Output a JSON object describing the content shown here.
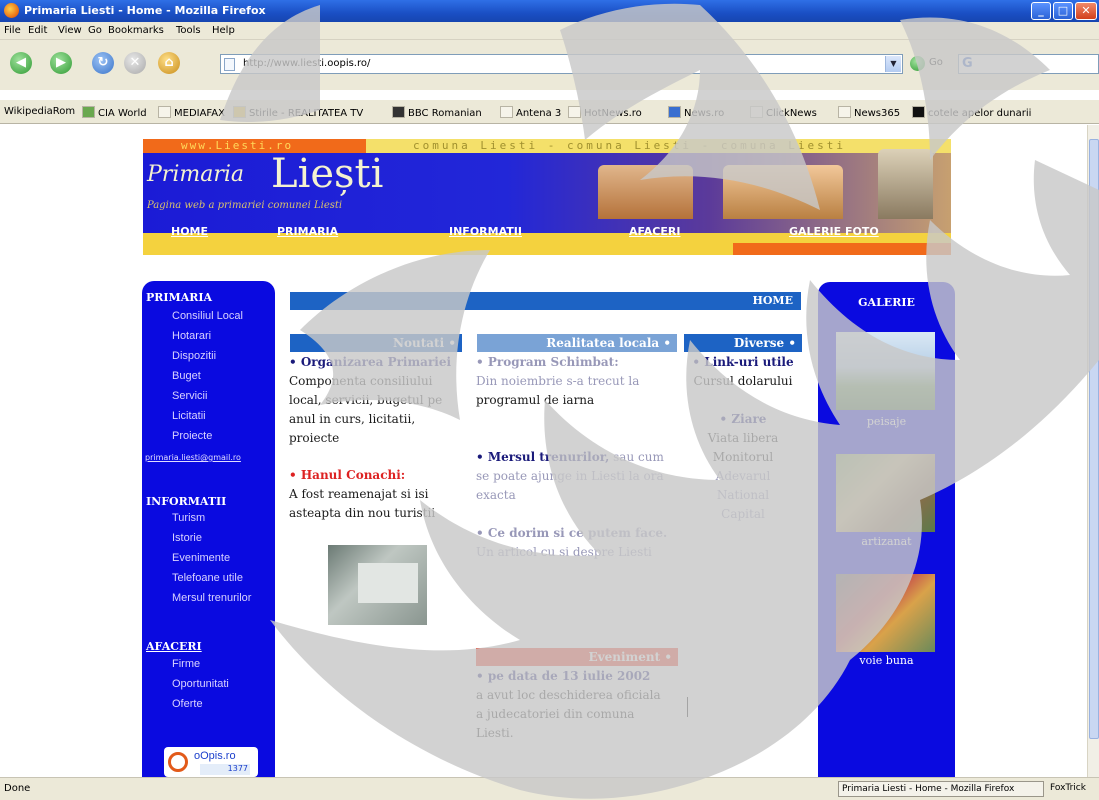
{
  "window": {
    "title": "Primaria Liesti - Home - Mozilla Firefox"
  },
  "menu": [
    "File",
    "Edit",
    "View",
    "Go",
    "Bookmarks",
    "Tools",
    "Help"
  ],
  "toolbar": {
    "url": "http://www.liesti.oopis.ro/",
    "go_label": "Go"
  },
  "bookmarks": [
    "WikipediaRom",
    "CIA World",
    "MEDIAFAX",
    "Stirile - REALITATEA TV",
    "BBC Romanian",
    "Antena 3",
    "HotNews.ro",
    "News.ro",
    "ClickNews",
    "News365",
    "cotele apelor dunarii"
  ],
  "banner": {
    "www": "www.Liesti.ro",
    "comuna": "comuna Liesti - comuna Liesti - comuna Liesti",
    "title1": "Primaria",
    "title2": "Liești",
    "subtitle": "Pagina web a primariei comunei Liesti",
    "nav": [
      "HOME",
      "PRIMARIA",
      "INFORMATII",
      "AFACERI",
      "GALERIE FOTO"
    ]
  },
  "leftnav": {
    "primaria_head": "PRIMARIA",
    "primaria_items": [
      "Consiliul Local",
      "Hotarari",
      "Dispozitii",
      "Buget",
      "Servicii",
      "Licitatii",
      "Proiecte"
    ],
    "email": "primaria.liesti@gmail.ro",
    "informatii_head": "INFORMATII",
    "informatii_items": [
      "Turism",
      "Istorie",
      "Evenimente",
      "Telefoane utile",
      "Mersul trenurilor"
    ],
    "afaceri_head": "AFACERI",
    "afaceri_items": [
      "Firme",
      "Oportunitati",
      "Oferte"
    ],
    "logo_text": "oOpis.ro",
    "logo_counter": "1377"
  },
  "main": {
    "home_label": "HOME",
    "col1": {
      "head": "Noutati •",
      "item1_title": "• Organizarea Primariei",
      "item1_lines": [
        "Componenta consiliului",
        "local, servicii, bugetul pe",
        "anul in curs, licitatii,",
        "proiecte"
      ],
      "item2_title": "• Hanul Conachi:",
      "item2_lines": [
        "A fost reamenajat si isi",
        "asteapta din nou turistii"
      ]
    },
    "col2": {
      "head": "Realitatea locala •",
      "item1_title": "• Program Schimbat:",
      "item1_lines": [
        "Din noiembrie s-a trecut la",
        "programul de iarna"
      ],
      "item2_title": "• Mersul trenurilor,",
      "item2_rest": " sau cum",
      "item2_lines": [
        "se poate ajunge in Liesti la ora",
        "exacta"
      ],
      "item3_title": "• Ce dorim si ce putem face.",
      "item3_lines": [
        "Un articol cu si despre Liesti"
      ]
    },
    "col3": {
      "head": "Diverse •",
      "link_title": "• Link-uri utile",
      "link_item": "Cursul dolarului",
      "ziare_title": "• Ziare",
      "ziare_items": [
        "Viata libera",
        "Monitorul",
        "Adevarul",
        "National",
        "Capital"
      ]
    },
    "eveniment": {
      "head": "Eveniment •",
      "title": "• pe data de 13 iulie 2002",
      "lines": [
        "a avut loc deschiderea oficiala",
        "a judecatoriei din comuna",
        "Liesti."
      ]
    }
  },
  "gallery": {
    "head": "GALERIE",
    "items": [
      "peisaje",
      "artizanat",
      "voie buna"
    ]
  },
  "status": {
    "left": "Done",
    "tab": "Primaria Liesti - Home - Mozilla Firefox",
    "ext": "FoxTrick"
  },
  "colors": {
    "title_blue": "#1a4fc4",
    "page_blue": "#0a0ae0",
    "accent_orange": "#f16a1a",
    "homebar_blue": "#1d63c4"
  }
}
